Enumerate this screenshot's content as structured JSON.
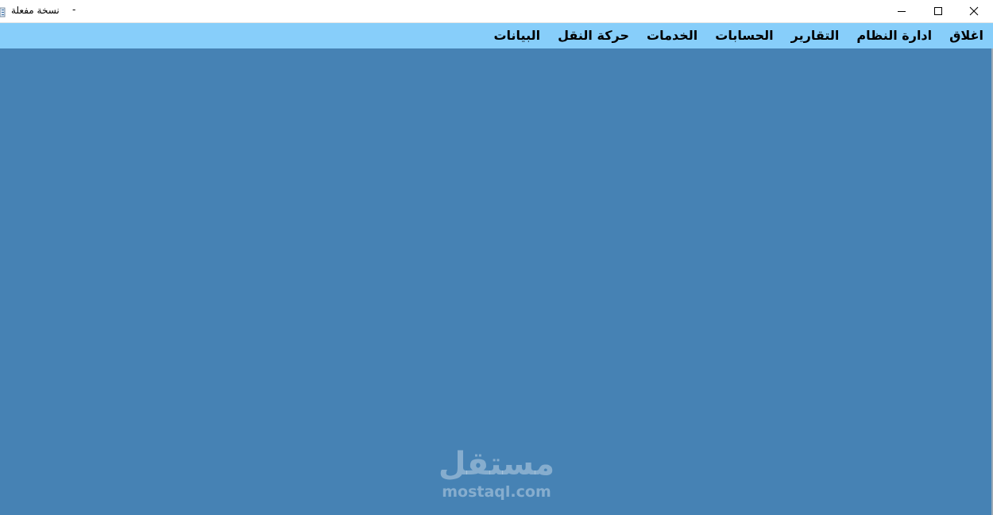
{
  "window": {
    "title": "نسخة مفعلة",
    "title_separator": "-",
    "controls": {
      "minimize_icon": "minimize-icon",
      "maximize_icon": "maximize-icon",
      "close_icon": "close-icon"
    }
  },
  "menu": {
    "items": [
      {
        "label": "البيانات"
      },
      {
        "label": "حركة النقل"
      },
      {
        "label": "الخدمات"
      },
      {
        "label": "الحسابات"
      },
      {
        "label": "التقارير"
      },
      {
        "label": "ادارة النظام"
      },
      {
        "label": "اغلاق"
      }
    ]
  },
  "watermark": {
    "arabic": "مستقل",
    "latin": "mostaql.com"
  },
  "colors": {
    "menubar_bg": "#87cefa",
    "client_bg": "#4682b4",
    "titlebar_bg": "#ffffff"
  }
}
